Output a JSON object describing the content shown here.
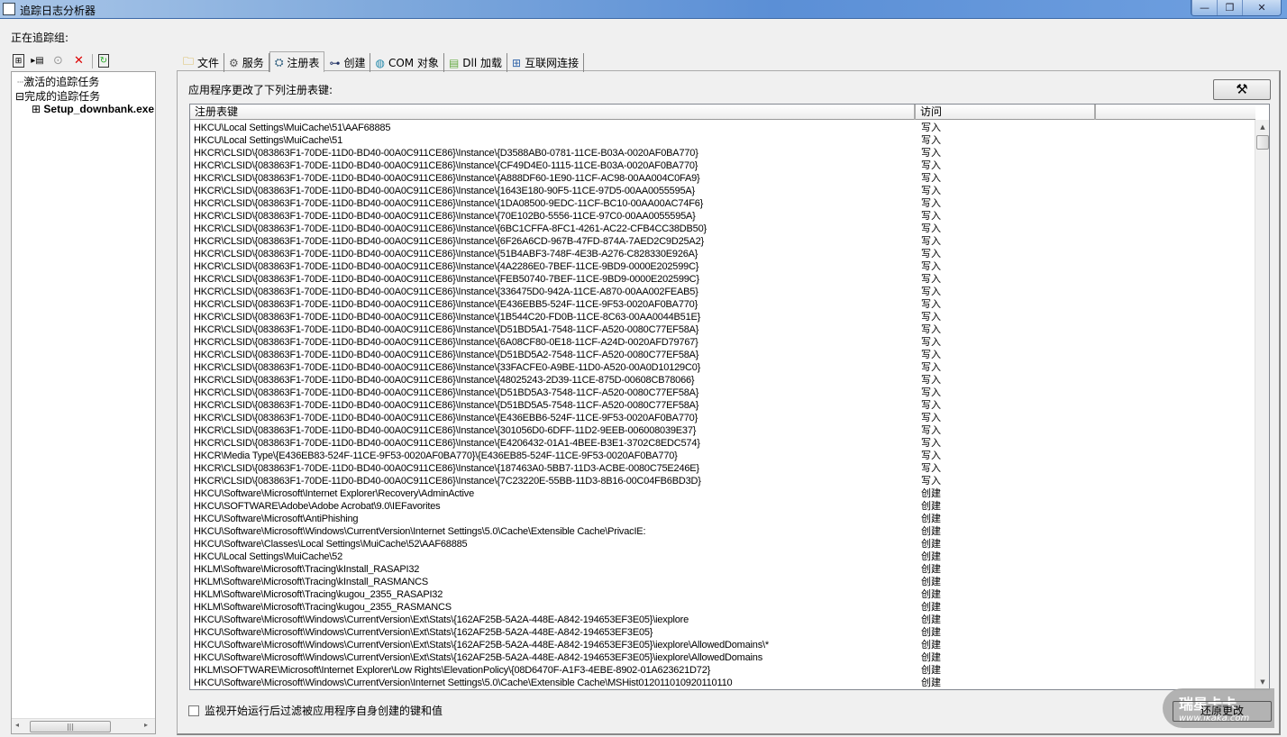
{
  "window": {
    "title": "追踪日志分析器",
    "minimize": "—",
    "restore": "❐",
    "close": "✕"
  },
  "tracking_label": "正在追踪组:",
  "tree": {
    "active": "激活的追踪任务",
    "done": "完成的追踪任务",
    "child": "Setup_downbank.exe",
    "expand_minus": "⊟",
    "expand_plus": "⊞"
  },
  "tabs": [
    {
      "label": "文件",
      "icon": "folder-icon"
    },
    {
      "label": "服务",
      "icon": "gear-icon"
    },
    {
      "label": "注册表",
      "icon": "registry-icon"
    },
    {
      "label": "创建",
      "icon": "tree-nodes-icon"
    },
    {
      "label": "COM 对象",
      "icon": "globe-icon"
    },
    {
      "label": "Dll 加载",
      "icon": "dll-file-icon"
    },
    {
      "label": "互联网连接",
      "icon": "network-icon"
    }
  ],
  "active_tab": "注册表",
  "panel": {
    "caption": "应用程序更改了下列注册表键:",
    "tools_icon": "⚒",
    "columns": [
      "注册表键",
      "访问",
      ""
    ],
    "rows": [
      {
        "key": "HKCU\\Local Settings\\MuiCache\\51\\AAF68885",
        "access": "写入"
      },
      {
        "key": "HKCU\\Local Settings\\MuiCache\\51",
        "access": "写入"
      },
      {
        "key": "HKCR\\CLSID\\{083863F1-70DE-11D0-BD40-00A0C911CE86}\\Instance\\{D3588AB0-0781-11CE-B03A-0020AF0BA770}",
        "access": "写入"
      },
      {
        "key": "HKCR\\CLSID\\{083863F1-70DE-11D0-BD40-00A0C911CE86}\\Instance\\{CF49D4E0-1115-11CE-B03A-0020AF0BA770}",
        "access": "写入"
      },
      {
        "key": "HKCR\\CLSID\\{083863F1-70DE-11D0-BD40-00A0C911CE86}\\Instance\\{A888DF60-1E90-11CF-AC98-00AA004C0FA9}",
        "access": "写入"
      },
      {
        "key": "HKCR\\CLSID\\{083863F1-70DE-11D0-BD40-00A0C911CE86}\\Instance\\{1643E180-90F5-11CE-97D5-00AA0055595A}",
        "access": "写入"
      },
      {
        "key": "HKCR\\CLSID\\{083863F1-70DE-11D0-BD40-00A0C911CE86}\\Instance\\{1DA08500-9EDC-11CF-BC10-00AA00AC74F6}",
        "access": "写入"
      },
      {
        "key": "HKCR\\CLSID\\{083863F1-70DE-11D0-BD40-00A0C911CE86}\\Instance\\{70E102B0-5556-11CE-97C0-00AA0055595A}",
        "access": "写入"
      },
      {
        "key": "HKCR\\CLSID\\{083863F1-70DE-11D0-BD40-00A0C911CE86}\\Instance\\{6BC1CFFA-8FC1-4261-AC22-CFB4CC38DB50}",
        "access": "写入"
      },
      {
        "key": "HKCR\\CLSID\\{083863F1-70DE-11D0-BD40-00A0C911CE86}\\Instance\\{6F26A6CD-967B-47FD-874A-7AED2C9D25A2}",
        "access": "写入"
      },
      {
        "key": "HKCR\\CLSID\\{083863F1-70DE-11D0-BD40-00A0C911CE86}\\Instance\\{51B4ABF3-748F-4E3B-A276-C828330E926A}",
        "access": "写入"
      },
      {
        "key": "HKCR\\CLSID\\{083863F1-70DE-11D0-BD40-00A0C911CE86}\\Instance\\{4A2286E0-7BEF-11CE-9BD9-0000E202599C}",
        "access": "写入"
      },
      {
        "key": "HKCR\\CLSID\\{083863F1-70DE-11D0-BD40-00A0C911CE86}\\Instance\\{FEB50740-7BEF-11CE-9BD9-0000E202599C}",
        "access": "写入"
      },
      {
        "key": "HKCR\\CLSID\\{083863F1-70DE-11D0-BD40-00A0C911CE86}\\Instance\\{336475D0-942A-11CE-A870-00AA002FEAB5}",
        "access": "写入"
      },
      {
        "key": "HKCR\\CLSID\\{083863F1-70DE-11D0-BD40-00A0C911CE86}\\Instance\\{E436EBB5-524F-11CE-9F53-0020AF0BA770}",
        "access": "写入"
      },
      {
        "key": "HKCR\\CLSID\\{083863F1-70DE-11D0-BD40-00A0C911CE86}\\Instance\\{1B544C20-FD0B-11CE-8C63-00AA0044B51E}",
        "access": "写入"
      },
      {
        "key": "HKCR\\CLSID\\{083863F1-70DE-11D0-BD40-00A0C911CE86}\\Instance\\{D51BD5A1-7548-11CF-A520-0080C77EF58A}",
        "access": "写入"
      },
      {
        "key": "HKCR\\CLSID\\{083863F1-70DE-11D0-BD40-00A0C911CE86}\\Instance\\{6A08CF80-0E18-11CF-A24D-0020AFD79767}",
        "access": "写入"
      },
      {
        "key": "HKCR\\CLSID\\{083863F1-70DE-11D0-BD40-00A0C911CE86}\\Instance\\{D51BD5A2-7548-11CF-A520-0080C77EF58A}",
        "access": "写入"
      },
      {
        "key": "HKCR\\CLSID\\{083863F1-70DE-11D0-BD40-00A0C911CE86}\\Instance\\{33FACFE0-A9BE-11D0-A520-00A0D10129C0}",
        "access": "写入"
      },
      {
        "key": "HKCR\\CLSID\\{083863F1-70DE-11D0-BD40-00A0C911CE86}\\Instance\\{48025243-2D39-11CE-875D-00608CB78066}",
        "access": "写入"
      },
      {
        "key": "HKCR\\CLSID\\{083863F1-70DE-11D0-BD40-00A0C911CE86}\\Instance\\{D51BD5A3-7548-11CF-A520-0080C77EF58A}",
        "access": "写入"
      },
      {
        "key": "HKCR\\CLSID\\{083863F1-70DE-11D0-BD40-00A0C911CE86}\\Instance\\{D51BD5A5-7548-11CF-A520-0080C77EF58A}",
        "access": "写入"
      },
      {
        "key": "HKCR\\CLSID\\{083863F1-70DE-11D0-BD40-00A0C911CE86}\\Instance\\{E436EBB6-524F-11CE-9F53-0020AF0BA770}",
        "access": "写入"
      },
      {
        "key": "HKCR\\CLSID\\{083863F1-70DE-11D0-BD40-00A0C911CE86}\\Instance\\{301056D0-6DFF-11D2-9EEB-006008039E37}",
        "access": "写入"
      },
      {
        "key": "HKCR\\CLSID\\{083863F1-70DE-11D0-BD40-00A0C911CE86}\\Instance\\{E4206432-01A1-4BEE-B3E1-3702C8EDC574}",
        "access": "写入"
      },
      {
        "key": "HKCR\\Media Type\\{E436EB83-524F-11CE-9F53-0020AF0BA770}\\{E436EB85-524F-11CE-9F53-0020AF0BA770}",
        "access": "写入"
      },
      {
        "key": "HKCR\\CLSID\\{083863F1-70DE-11D0-BD40-00A0C911CE86}\\Instance\\{187463A0-5BB7-11D3-ACBE-0080C75E246E}",
        "access": "写入"
      },
      {
        "key": "HKCR\\CLSID\\{083863F1-70DE-11D0-BD40-00A0C911CE86}\\Instance\\{7C23220E-55BB-11D3-8B16-00C04FB6BD3D}",
        "access": "写入"
      },
      {
        "key": "HKCU\\Software\\Microsoft\\Internet Explorer\\Recovery\\AdminActive",
        "access": "创建"
      },
      {
        "key": "HKCU\\SOFTWARE\\Adobe\\Adobe Acrobat\\9.0\\IEFavorites",
        "access": "创建"
      },
      {
        "key": "HKCU\\Software\\Microsoft\\AntiPhishing",
        "access": "创建"
      },
      {
        "key": "HKCU\\Software\\Microsoft\\Windows\\CurrentVersion\\Internet Settings\\5.0\\Cache\\Extensible Cache\\PrivacIE:",
        "access": "创建"
      },
      {
        "key": "HKCU\\Software\\Classes\\Local Settings\\MuiCache\\52\\AAF68885",
        "access": "创建"
      },
      {
        "key": "HKCU\\Local Settings\\MuiCache\\52",
        "access": "创建"
      },
      {
        "key": "HKLM\\Software\\Microsoft\\Tracing\\kInstall_RASAPI32",
        "access": "创建"
      },
      {
        "key": "HKLM\\Software\\Microsoft\\Tracing\\kInstall_RASMANCS",
        "access": "创建"
      },
      {
        "key": "HKLM\\Software\\Microsoft\\Tracing\\kugou_2355_RASAPI32",
        "access": "创建"
      },
      {
        "key": "HKLM\\Software\\Microsoft\\Tracing\\kugou_2355_RASMANCS",
        "access": "创建"
      },
      {
        "key": "HKCU\\Software\\Microsoft\\Windows\\CurrentVersion\\Ext\\Stats\\{162AF25B-5A2A-448E-A842-194653EF3E05}\\iexplore",
        "access": "创建"
      },
      {
        "key": "HKCU\\Software\\Microsoft\\Windows\\CurrentVersion\\Ext\\Stats\\{162AF25B-5A2A-448E-A842-194653EF3E05}",
        "access": "创建"
      },
      {
        "key": "HKCU\\Software\\Microsoft\\Windows\\CurrentVersion\\Ext\\Stats\\{162AF25B-5A2A-448E-A842-194653EF3E05}\\iexplore\\AllowedDomains\\*",
        "access": "创建"
      },
      {
        "key": "HKCU\\Software\\Microsoft\\Windows\\CurrentVersion\\Ext\\Stats\\{162AF25B-5A2A-448E-A842-194653EF3E05}\\iexplore\\AllowedDomains",
        "access": "创建"
      },
      {
        "key": "HKLM\\SOFTWARE\\Microsoft\\Internet Explorer\\Low Rights\\ElevationPolicy\\{08D6470F-A1F3-4EBE-8902-01A623621D72}",
        "access": "创建"
      },
      {
        "key": "HKCU\\Software\\Microsoft\\Windows\\CurrentVersion\\Internet Settings\\5.0\\Cache\\Extensible Cache\\MSHist012011010920110110",
        "access": "创建"
      }
    ]
  },
  "filter_checkbox": {
    "label": "监视开始运行后过滤被应用程序自身创建的键和值",
    "checked": false
  },
  "restore_button": "还原更改",
  "watermark": {
    "text": "瑞星卡卡",
    "url": "www.ikaka.com"
  }
}
